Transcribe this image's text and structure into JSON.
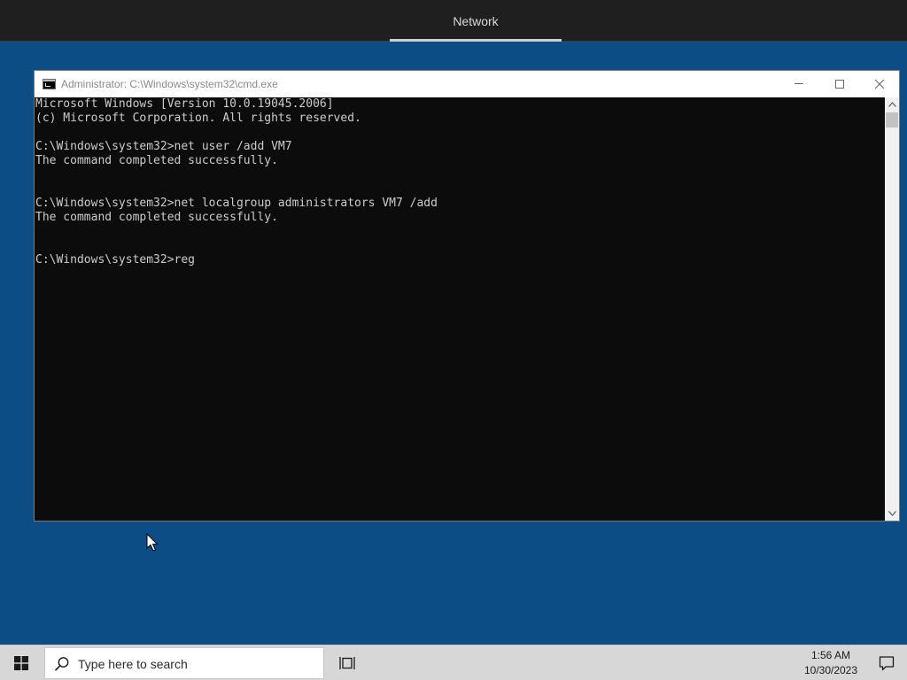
{
  "topbar": {
    "tab_label": "Network"
  },
  "cmd_window": {
    "title": "Administrator: C:\\Windows\\system32\\cmd.exe",
    "icon": "cmd-icon",
    "console_lines": [
      "Microsoft Windows [Version 10.0.19045.2006]",
      "(c) Microsoft Corporation. All rights reserved.",
      "",
      "C:\\Windows\\system32>net user /add VM7",
      "The command completed successfully.",
      "",
      "",
      "C:\\Windows\\system32>net localgroup administrators VM7 /add",
      "The command completed successfully.",
      "",
      "",
      "C:\\Windows\\system32>reg"
    ],
    "text_color": "#cccccc",
    "background_color": "#0c0c0c"
  },
  "taskbar": {
    "start_icon": "windows-logo-icon",
    "search_placeholder": "Type here to search",
    "taskview_icon": "task-view-icon",
    "clock_time": "1:56 AM",
    "clock_date": "10/30/2023",
    "notification_icon": "action-center-icon"
  },
  "colors": {
    "desktop": "#0c4d86",
    "topbar": "#1f1f1f",
    "taskbar": "#d7d7d7"
  }
}
